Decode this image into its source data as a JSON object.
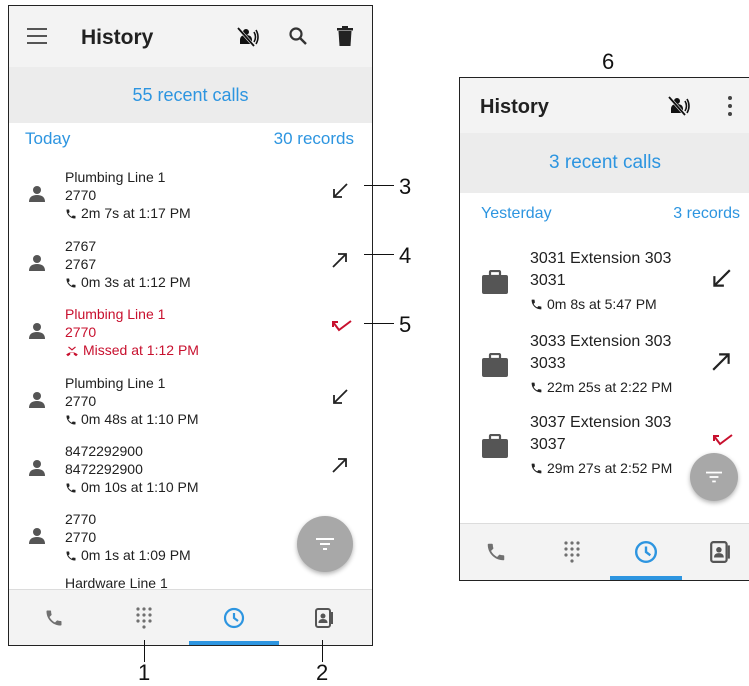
{
  "left_screen": {
    "title": "History",
    "banner": "55 recent calls",
    "section": {
      "label": "Today",
      "count": "30 records"
    },
    "icons": {
      "menu": "hamburger-menu-icon",
      "mute_call": "speaker-off-icon",
      "search": "search-icon",
      "delete": "trash-icon"
    },
    "calls": [
      {
        "name": "Plumbing Line 1",
        "number": "2770",
        "detail": "2m 7s  at 1:17 PM",
        "direction": "incoming",
        "missed": false
      },
      {
        "name": "2767",
        "number": "2767",
        "detail": "0m 3s  at 1:12 PM",
        "direction": "outgoing",
        "missed": false
      },
      {
        "name": "Plumbing Line 1",
        "number": "2770",
        "detail": "Missed  at 1:12 PM",
        "direction": "missed",
        "missed": true
      },
      {
        "name": "Plumbing Line 1",
        "number": "2770",
        "detail": "0m 48s  at 1:10 PM",
        "direction": "incoming",
        "missed": false
      },
      {
        "name": "8472292900",
        "number": "8472292900",
        "detail": "0m 10s  at 1:10 PM",
        "direction": "outgoing",
        "missed": false
      },
      {
        "name": "2770",
        "number": "2770",
        "detail": "0m 1s  at 1:09 PM",
        "direction": "outgoing",
        "missed": false
      },
      {
        "name": "Hardware Line 1",
        "number": "",
        "detail": "",
        "direction": "",
        "missed": false
      }
    ],
    "nav": [
      "phone-icon",
      "dialpad-icon",
      "history-clock-icon",
      "contacts-icon"
    ],
    "active_nav": "history-clock-icon"
  },
  "right_screen": {
    "title": "History",
    "banner": "3 recent calls",
    "section": {
      "label": "Yesterday",
      "count": "3 records"
    },
    "icons": {
      "mute_call": "speaker-off-icon",
      "overflow": "more-vert-icon"
    },
    "calls": [
      {
        "name": "3031 Extension 303",
        "number": "3031",
        "detail": "0m 8s  at 5:47 PM",
        "direction": "incoming"
      },
      {
        "name": "3033 Extension 303",
        "number": "3033",
        "detail": "22m 25s  at 2:22 PM",
        "direction": "outgoing"
      },
      {
        "name": "3037 Extension 303",
        "number": "3037",
        "detail": "29m 27s  at 2:52 PM",
        "direction": "missed"
      }
    ],
    "nav": [
      "phone-icon",
      "dialpad-icon",
      "history-clock-icon",
      "contacts-icon"
    ],
    "active_nav": "history-clock-icon"
  },
  "callouts": {
    "c1": "1",
    "c2": "2",
    "c3": "3",
    "c4": "4",
    "c5": "5",
    "c6": "6"
  },
  "colors": {
    "accent": "#2d95e0",
    "missed": "#c8102e",
    "fab": "#a8a8a8"
  }
}
